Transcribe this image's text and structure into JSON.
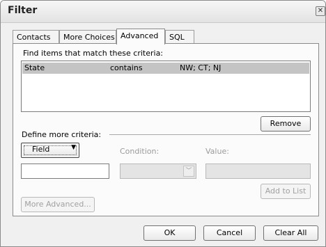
{
  "window": {
    "title": "Filter",
    "close_glyph": "✕"
  },
  "tabs": [
    {
      "label": "Contacts",
      "active": false
    },
    {
      "label": "More Choices",
      "active": false
    },
    {
      "label": "Advanced",
      "active": true
    },
    {
      "label": "SQL",
      "active": false
    }
  ],
  "advanced": {
    "find_label": "Find items that match these criteria:",
    "criteria": [
      {
        "field": "State",
        "condition": "contains",
        "value": "NW; CT; NJ"
      }
    ],
    "remove_label": "Remove",
    "define_label": "Define more criteria:",
    "field_button_label": "Field",
    "field_button_arrow": "▼",
    "condition_label": "Condition:",
    "value_label": "Value:",
    "combo_arrow": "﹀",
    "add_to_list_label": "Add to List",
    "more_advanced_label": "More Advanced..."
  },
  "footer": {
    "ok_label": "OK",
    "cancel_label": "Cancel",
    "clear_all_label": "Clear All"
  }
}
